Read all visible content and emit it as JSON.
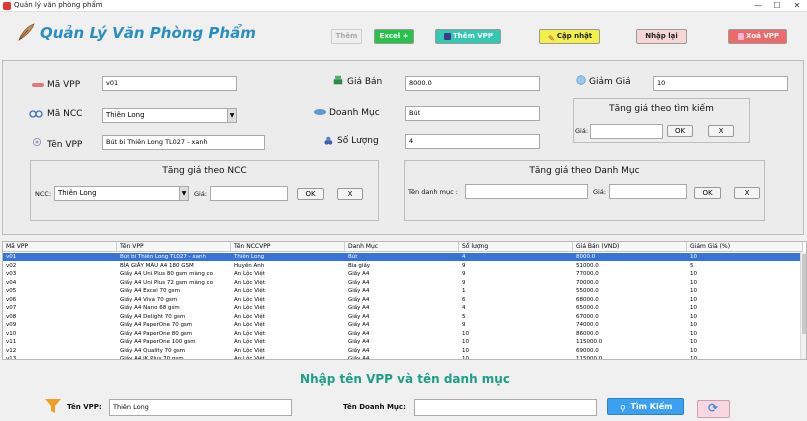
{
  "window": {
    "title": "Quản lý văn phòng phẩm",
    "controls": [
      "—",
      "☐",
      "✕"
    ]
  },
  "app": {
    "title": "Quản Lý Văn Phòng Phẩm"
  },
  "toolbar": {
    "them": "Thêm",
    "excel": "Excel +",
    "them_vpp": "Thêm VPP",
    "cap_nhat": "Cập nhật",
    "nhap_lai": "Nhập lại",
    "xoa_vpp": "Xoá VPP"
  },
  "form": {
    "ma_vpp_label": "Mã VPP",
    "ma_vpp_value": "v01",
    "ma_ncc_label": "Mã NCC",
    "ma_ncc_value": "Thiên Long",
    "ten_vpp_label": "Tên VPP",
    "ten_vpp_value": "Bút bi Thiên Long TL027 - xanh",
    "gia_ban_label": "Giá Bán",
    "gia_ban_value": "8000.0",
    "doanh_muc_label": "Doanh Mục",
    "doanh_muc_value": "Bút",
    "so_luong_label": "Số Lượng",
    "so_luong_value": "4",
    "giam_gia_label": "Giảm Giá",
    "giam_gia_value": "10"
  },
  "tang_gia_tim_kiem": {
    "title": "Tăng giá theo tìm kiếm",
    "gia_label": "Giá:",
    "gia_value": "",
    "ok": "OK",
    "x": "X"
  },
  "tang_gia_ncc": {
    "title": "Tăng giá theo NCC",
    "ncc_label": "NCC:",
    "ncc_value": "Thiên Long",
    "gia_label": "Giá:",
    "gia_value": "",
    "ok": "OK",
    "x": "X"
  },
  "tang_gia_danh_muc": {
    "title": "Tăng giá theo Danh Mục",
    "ten_dm_label": "Tên danh mục :",
    "ten_dm_value": "",
    "gia_label": "Giá:",
    "gia_value": "",
    "ok": "OK",
    "x": "X"
  },
  "table": {
    "columns": [
      "Mã VPP",
      "Tên VPP",
      "Tên NCCVPP",
      "Danh Mục",
      "Số lượng",
      "Giá Bán (VND)",
      "Giảm Giá (%)"
    ],
    "rows": [
      [
        "v01",
        "Bút bi Thiên Long TL027 - xanh",
        "Thiên Long",
        "Bút",
        "4",
        "8000.0",
        "10"
      ],
      [
        "v02",
        "BÌA GIẤY MÀU A4 180 GSM",
        "Huyền Anh",
        "Bìa giấy",
        "9",
        "51000.0",
        "5"
      ],
      [
        "v03",
        "Giấy A4 Uni Plus 80 gsm màng co",
        "An Lộc Việt",
        "Giấy A4",
        "9",
        "77000.0",
        "10"
      ],
      [
        "v04",
        "Giấy A4 Uni Plus 72 gsm màng co",
        "An Lộc Việt",
        "Giấy A4",
        "9",
        "70000.0",
        "10"
      ],
      [
        "v05",
        "Giấy A4 Excel 70 gsm",
        "An Lộc Việt",
        "Giấy A4",
        "1",
        "55000.0",
        "10"
      ],
      [
        "v06",
        "Giấy A4 Viva 70 gsm",
        "An Lộc Việt",
        "Giấy A4",
        "6",
        "68000.0",
        "10"
      ],
      [
        "v07",
        "Giấy A4 Nano 68 gsm",
        "An Lộc Việt",
        "Giấy A4",
        "4",
        "65000.0",
        "10"
      ],
      [
        "v08",
        "Giấy A4 Delight 70 gsm",
        "An Lộc Việt",
        "Giấy A4",
        "5",
        "67000.0",
        "10"
      ],
      [
        "v09",
        "Giấy A4 PaperOne 70 gsm",
        "An Lộc Việt",
        "Giấy A4",
        "9",
        "74000.0",
        "10"
      ],
      [
        "v10",
        "Giấy A4 PaperOne 80 gsm",
        "An Lộc Việt",
        "Giấy A4",
        "10",
        "86000.0",
        "10"
      ],
      [
        "v11",
        "Giấy A4 PaperOne 100 gsm",
        "An Lộc Việt",
        "Giấy A4",
        "10",
        "115000.0",
        "10"
      ],
      [
        "v12",
        "Giấy A4 Quality 70 gsm",
        "An Lộc Việt",
        "Giấy A4",
        "10",
        "69000.0",
        "10"
      ],
      [
        "v13",
        "Giấy A4 IK Plus 70 gsm",
        "An Lộc Việt",
        "Giấy A4",
        "10",
        "115000.0",
        "10"
      ]
    ]
  },
  "search": {
    "title": "Nhập tên VPP và tên danh mục",
    "ten_vpp_label": "Tên VPP:",
    "ten_vpp_value": "Thiên Long",
    "ten_dm_label": "Tên Doanh Mục:",
    "ten_dm_value": "",
    "tim_kiem": "Tìm Kiếm"
  },
  "colors": {
    "accent": "#2a8fc0",
    "excel": "#27c24a",
    "them_vpp": "#35c8b0",
    "cap_nhat": "#f2ee4a",
    "nhap_lai": "#f9d6d6",
    "xoa_vpp": "#ec6a6a",
    "search_title": "#1d9e88",
    "selected_row": "#3874d8"
  }
}
